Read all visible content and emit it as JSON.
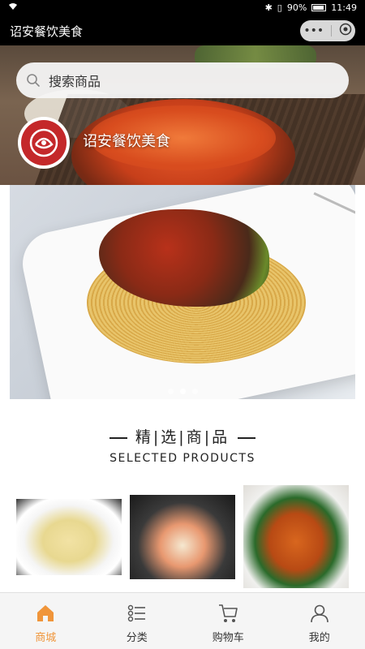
{
  "status_bar": {
    "battery": "90%",
    "time": "11:49"
  },
  "title_bar": {
    "title": "诏安餐饮美食",
    "more_icon": "more-dots-icon",
    "close_icon": "close-circle-icon"
  },
  "search": {
    "placeholder": "搜索商品"
  },
  "store": {
    "name": "诏安餐饮美食"
  },
  "banner": {
    "slide_count": 3,
    "active_slide": 2
  },
  "section": {
    "title": "精|选|商|品",
    "subtitle": "SELECTED PRODUCTS"
  },
  "tabbar": {
    "active_color": "#f0953a",
    "items": [
      {
        "label": "商城",
        "icon": "home-icon",
        "active": true
      },
      {
        "label": "分类",
        "icon": "category-list-icon",
        "active": false
      },
      {
        "label": "购物车",
        "icon": "cart-icon",
        "active": false
      },
      {
        "label": "我的",
        "icon": "user-icon",
        "active": false
      }
    ]
  }
}
